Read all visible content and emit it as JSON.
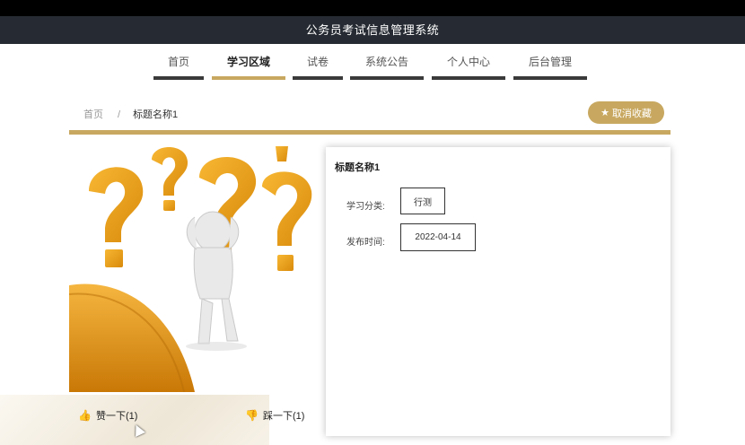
{
  "app": {
    "title": "公务员考试信息管理系统"
  },
  "nav": {
    "items": [
      {
        "label": "首页"
      },
      {
        "label": "学习区域"
      },
      {
        "label": "试卷"
      },
      {
        "label": "系统公告"
      },
      {
        "label": "个人中心"
      },
      {
        "label": "后台管理"
      }
    ],
    "active": "学习区域"
  },
  "breadcrumb": {
    "home": "首页",
    "separator": "/",
    "current": "标题名称1"
  },
  "actions": {
    "favorite_label": "取消收藏",
    "favorite_icon": "star-icon"
  },
  "detail": {
    "title": "标题名称1",
    "category_label": "学习分类:",
    "category_value": "行测",
    "date_label": "发布时间:",
    "date_value": "2022-04-14"
  },
  "votes": {
    "like_label": "赞一下(1)",
    "dislike_label": "踩一下(1)",
    "like_icon": "thumbs-up-icon",
    "dislike_icon": "thumbs-down-icon"
  },
  "colors": {
    "accent": "#c8a860",
    "header_bg": "#262b33",
    "nav_bar": "#3a3a3a"
  }
}
